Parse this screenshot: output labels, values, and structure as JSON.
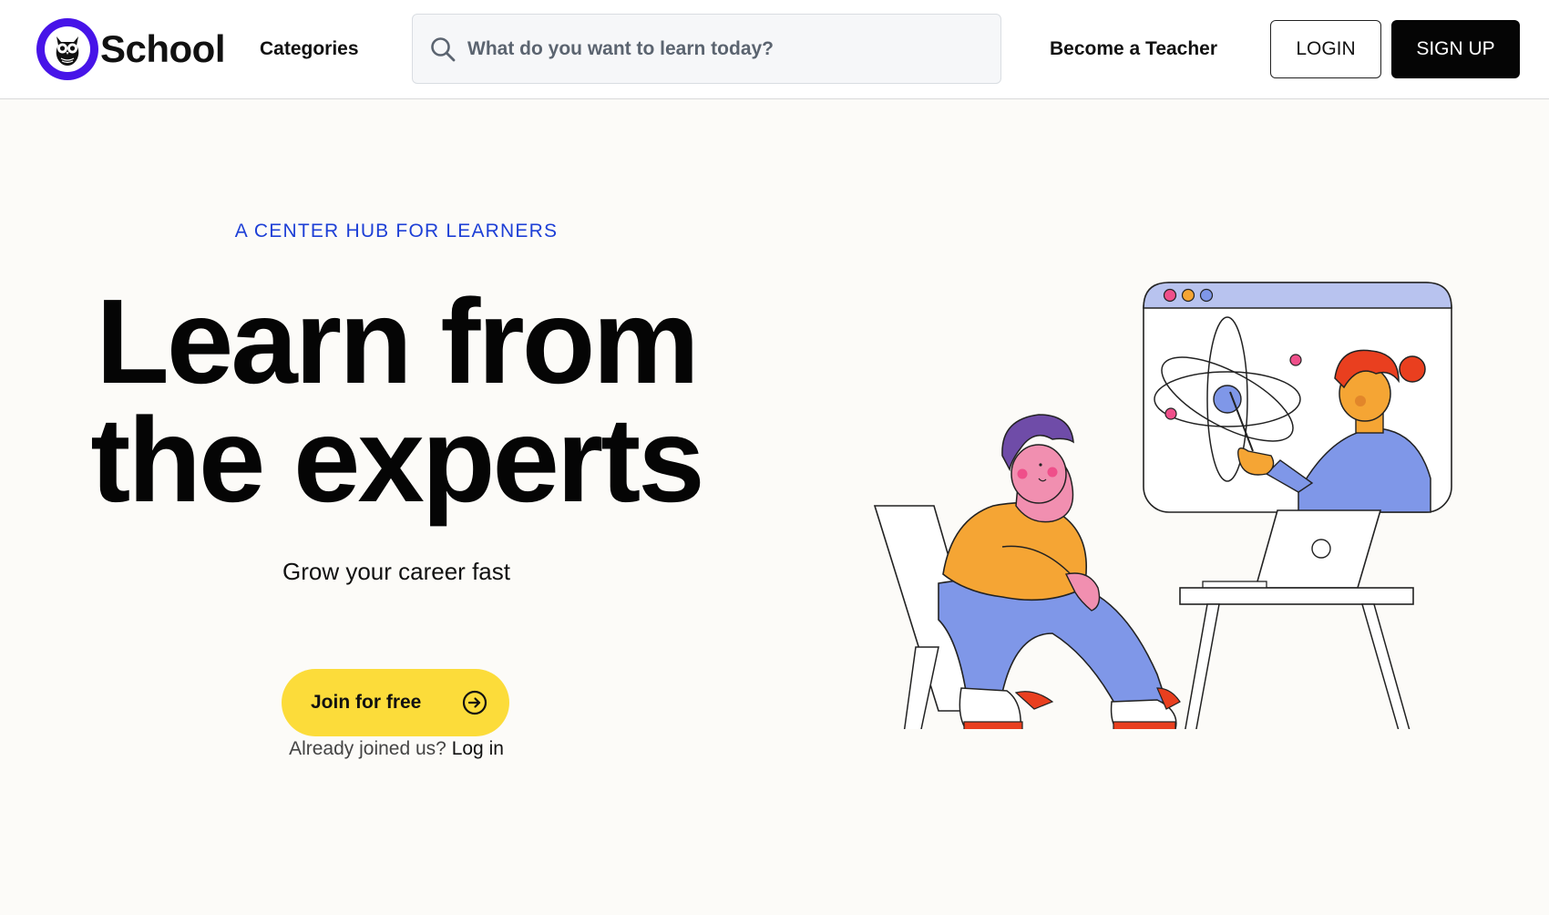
{
  "header": {
    "logo_text": "School",
    "categories_label": "Categories",
    "search_placeholder": "What do you want to learn today?",
    "become_teacher_label": "Become a Teacher",
    "login_label": "LOGIN",
    "signup_label": "SIGN UP"
  },
  "hero": {
    "eyebrow": "A CENTER HUB FOR LEARNERS",
    "headline_line1": "Learn from",
    "headline_line2": "the experts",
    "subhead": "Grow your career fast",
    "join_label": "Join for free",
    "already_text": "Already joined us?",
    "login_link": "Log in"
  },
  "icons": {
    "logo": "owl-logo-icon",
    "search": "search-icon",
    "join_arrow": "arrow-right-circle-icon",
    "illustration": "online-class-illustration"
  },
  "colors": {
    "accent_blue": "#1d3fd6",
    "logo_purple": "#4714e8",
    "join_yellow": "#fcdc3a",
    "signup_black": "#050505",
    "background": "#fcfbf8"
  }
}
